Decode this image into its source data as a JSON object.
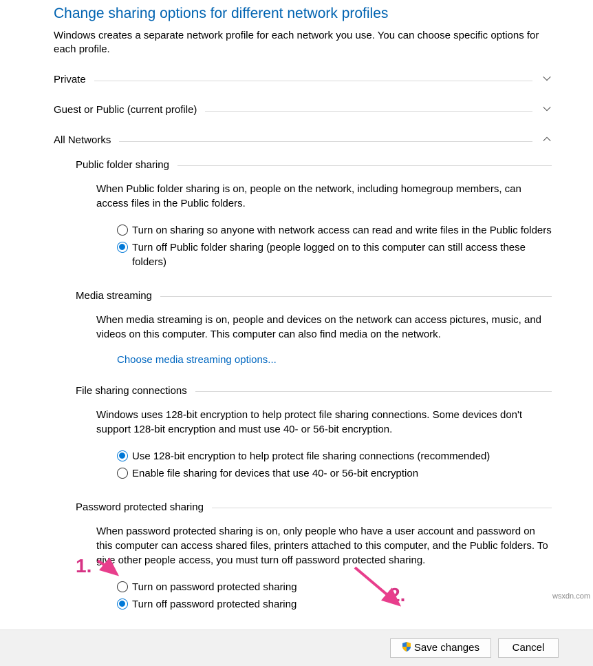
{
  "heading": "Change sharing options for different network profiles",
  "intro": "Windows creates a separate network profile for each network you use. You can choose specific options for each profile.",
  "profiles": {
    "private": "Private",
    "guest": "Guest or Public (current profile)",
    "all": "All Networks"
  },
  "publicFolder": {
    "title": "Public folder sharing",
    "body": "When Public folder sharing is on, people on the network, including homegroup members, can access files in the Public folders.",
    "opt_on": "Turn on sharing so anyone with network access can read and write files in the Public folders",
    "opt_off": "Turn off Public folder sharing (people logged on to this computer can still access these folders)"
  },
  "media": {
    "title": "Media streaming",
    "body": "When media streaming is on, people and devices on the network can access pictures, music, and videos on this computer. This computer can also find media on the network.",
    "link": "Choose media streaming options..."
  },
  "fileShare": {
    "title": "File sharing connections",
    "body": "Windows uses 128-bit encryption to help protect file sharing connections. Some devices don't support 128-bit encryption and must use 40- or 56-bit encryption.",
    "opt_128": "Use 128-bit encryption to help protect file sharing connections (recommended)",
    "opt_40": "Enable file sharing for devices that use 40- or 56-bit encryption"
  },
  "password": {
    "title": "Password protected sharing",
    "body": "When password protected sharing is on, only people who have a user account and password on this computer can access shared files, printers attached to this computer, and the Public folders. To give other people access, you must turn off password protected sharing.",
    "opt_on": "Turn on password protected sharing",
    "opt_off": "Turn off password protected sharing"
  },
  "buttons": {
    "save": "Save changes",
    "cancel": "Cancel"
  },
  "annot": {
    "one": "1.",
    "two": "2."
  },
  "watermark": "wsxdn.com"
}
